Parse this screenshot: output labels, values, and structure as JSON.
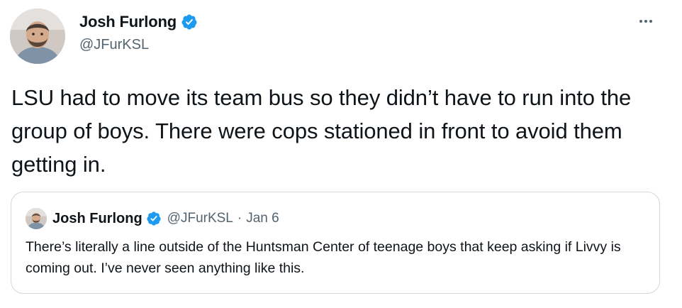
{
  "author": {
    "display_name": "Josh Furlong",
    "handle": "@JFurKSL",
    "verified": true
  },
  "tweet": {
    "text": "LSU had to move its team bus so they didn’t have to run into the group of boys. There were cops stationed in front to avoid them getting in."
  },
  "quoted_tweet": {
    "display_name": "Josh Furlong",
    "handle": "@JFurKSL",
    "separator": "·",
    "date": "Jan 6",
    "verified": true,
    "text": "There’s literally a line outside of the Huntsman Center of teenage boys that keep asking if Livvy is coming out. I’ve never seen anything like this."
  },
  "icons": {
    "verified": "verified-badge-icon",
    "more": "more-options-icon"
  },
  "colors": {
    "verified_blue": "#1d9bf0",
    "text_primary": "#0f1419",
    "text_secondary": "#536471",
    "border": "#cfd9de"
  }
}
